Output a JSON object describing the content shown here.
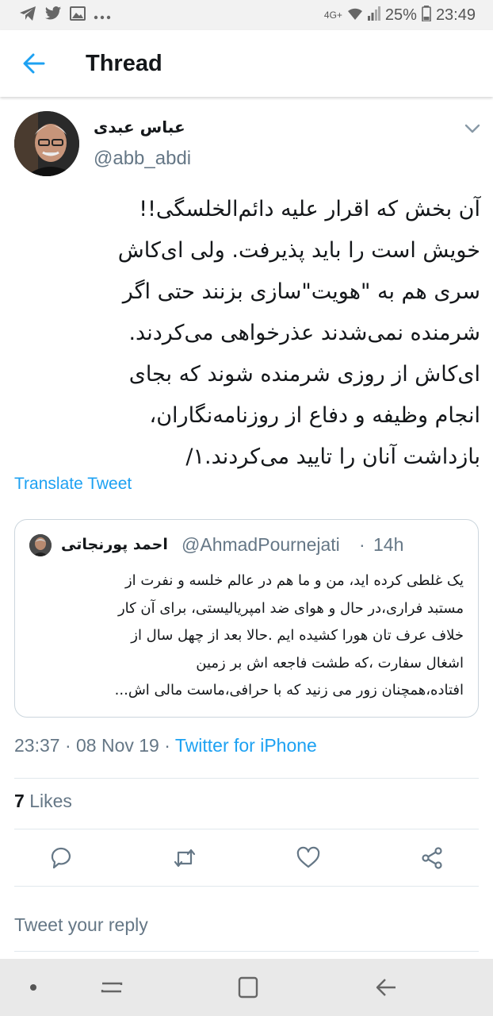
{
  "status_bar": {
    "network": "4G+",
    "battery": "25%",
    "time": "23:49",
    "icons": [
      "telegram-icon",
      "twitter-icon",
      "gallery-icon",
      "more-icon",
      "wifi-icon",
      "signal-icon",
      "battery-icon"
    ]
  },
  "header": {
    "title": "Thread",
    "back_icon": "back-arrow-icon"
  },
  "tweet": {
    "author_name": "عباس عبدی",
    "author_handle": "@abb_abdi",
    "lines": [
      "آن بخش که اقرار علیه دائم‌الخلسگی!!",
      "خویش است را باید پذیرفت. ولی ای‌کاش",
      "سری هم به \"هویت\"سازی بزنند حتی اگر",
      "شرمنده نمی‌شدند عذرخواهی می‌کردند.",
      "ای‌کاش از روزی شرمنده شوند که بجای",
      "انجام وظیفه و دفاع از روزنامه‌نگاران،",
      "بازداشت آنان را تایید می‌کردند.۱/"
    ],
    "translate_label": "Translate Tweet",
    "timestamp": "23:37 · 08 Nov 19 · ",
    "source": "Twitter for iPhone",
    "likes_count": "7",
    "likes_label": "Likes"
  },
  "quoted_tweet": {
    "author_name": "احمد پورنجاتی",
    "author_handle": "@AhmadPournejati",
    "separator": "·",
    "time": "14h",
    "lines": [
      "یک غلطی کرده اید، من و ما هم در عالم خلسه و نفرت از",
      "مستبد فراری،در حال و هوای ضد امپریالیستی، برای آن کار",
      "خلاف عرف تان هورا کشیده ایم .حالا بعد از چهل سال از",
      "اشغال سفارت ،که طشت فاجعه اش بر زمین",
      "افتاده،همچنان زور می زنید که با حرافی،ماست مالی اش..."
    ]
  },
  "actions": [
    "reply-icon",
    "retweet-icon",
    "like-icon",
    "share-icon"
  ],
  "reply_placeholder": "Tweet your reply",
  "colors": {
    "accent": "#1da1f2",
    "text": "#14171a",
    "secondary": "#657786",
    "border": "#e1e8ed"
  }
}
